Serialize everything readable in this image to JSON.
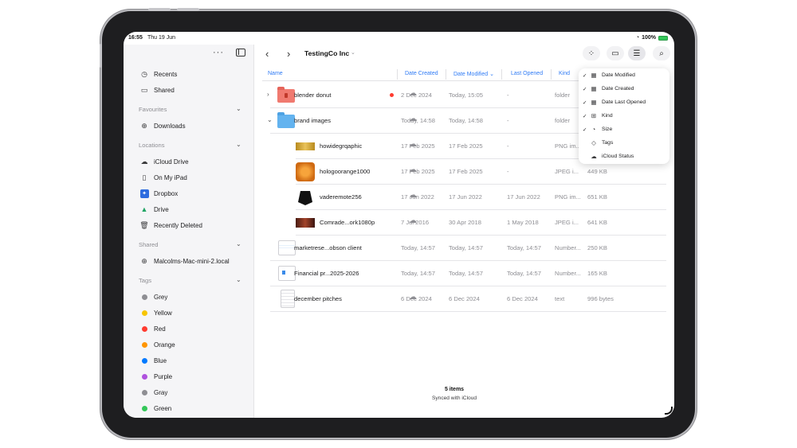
{
  "status_bar": {
    "time": "16:55",
    "date": "Thu 19 Jun",
    "battery": "100%"
  },
  "sidebar": {
    "more": "···",
    "items_top": [
      {
        "icon": "clock-icon",
        "label": "Recents"
      },
      {
        "icon": "shared-folder-icon",
        "label": "Shared"
      }
    ],
    "favourites": {
      "title": "Favourites",
      "items": [
        {
          "icon": "download-icon",
          "label": "Downloads"
        }
      ]
    },
    "locations": {
      "title": "Locations",
      "items": [
        {
          "icon": "icloud-icon",
          "label": "iCloud Drive"
        },
        {
          "icon": "ipad-icon",
          "label": "On My iPad"
        },
        {
          "icon": "dropbox-icon",
          "label": "Dropbox"
        },
        {
          "icon": "google-drive-icon",
          "label": "Drive"
        },
        {
          "icon": "trash-icon",
          "label": "Recently Deleted"
        }
      ]
    },
    "shared": {
      "title": "Shared",
      "items": [
        {
          "icon": "globe-icon",
          "label": "Malcolms-Mac-mini-2.local"
        }
      ]
    },
    "tags": {
      "title": "Tags",
      "items": [
        {
          "label": "Grey",
          "color": "#8e8e93"
        },
        {
          "label": "Yellow",
          "color": "#f7c500"
        },
        {
          "label": "Red",
          "color": "#ff3b30"
        },
        {
          "label": "Orange",
          "color": "#ff9500"
        },
        {
          "label": "Blue",
          "color": "#007aff"
        },
        {
          "label": "Purple",
          "color": "#af52de"
        },
        {
          "label": "Gray",
          "color": "#8e8e93"
        },
        {
          "label": "Green",
          "color": "#34c759"
        }
      ]
    }
  },
  "toolbar": {
    "title": "TestingCo Inc"
  },
  "columns": {
    "name": "Name",
    "date_created": "Date Created",
    "date_modified": "Date Modified",
    "last_opened": "Last Opened",
    "kind": "Kind"
  },
  "rows": [
    {
      "name": "blender donut",
      "created": "2 Dec 2024",
      "modified": "Today, 15:05",
      "opened": "-",
      "kind": "folder",
      "size": ""
    },
    {
      "name": "brand images",
      "created": "Today, 14:58",
      "modified": "Today, 14:58",
      "opened": "-",
      "kind": "folder",
      "size": ""
    },
    {
      "name": "howidegrqaphic",
      "created": "17 Feb 2025",
      "modified": "17 Feb 2025",
      "opened": "-",
      "kind": "PNG im...",
      "size": ""
    },
    {
      "name": "hologoorange1000",
      "created": "17 Feb 2025",
      "modified": "17 Feb 2025",
      "opened": "-",
      "kind": "JPEG i...",
      "size": "449 KB"
    },
    {
      "name": "vaderemote256",
      "created": "17 Jun 2022",
      "modified": "17 Jun 2022",
      "opened": "17 Jun 2022",
      "kind": "PNG im...",
      "size": "651 KB"
    },
    {
      "name": "Comrade...ork1080p",
      "created": "7 Jul 2016",
      "modified": "30 Apr 2018",
      "opened": "1 May 2018",
      "kind": "JPEG i...",
      "size": "641 KB"
    },
    {
      "name": "marketrese...obson client",
      "created": "Today, 14:57",
      "modified": "Today, 14:57",
      "opened": "Today, 14:57",
      "kind": "Number...",
      "size": "250 KB"
    },
    {
      "name": "Financial pr...2025-2026",
      "created": "Today, 14:57",
      "modified": "Today, 14:57",
      "opened": "Today, 14:57",
      "kind": "Number...",
      "size": "165 KB"
    },
    {
      "name": "december pitches",
      "created": "6 Dec 2024",
      "modified": "6 Dec 2024",
      "opened": "6 Dec 2024",
      "kind": "text",
      "size": "996 bytes"
    }
  ],
  "popover": {
    "items": [
      {
        "label": "Date Modified",
        "checked": true,
        "icon": "calendar-icon"
      },
      {
        "label": "Date Created",
        "checked": true,
        "icon": "calendar-icon"
      },
      {
        "label": "Date Last Opened",
        "checked": true,
        "icon": "calendar-clock-icon"
      },
      {
        "label": "Kind",
        "checked": true,
        "icon": "kind-icon"
      },
      {
        "label": "Size",
        "checked": true,
        "icon": "gauge-icon"
      },
      {
        "label": "Tags",
        "checked": false,
        "icon": "tag-icon"
      },
      {
        "label": "iCloud Status",
        "checked": false,
        "icon": "icloud-icon"
      }
    ]
  },
  "footer": {
    "count": "5 items",
    "sync": "Synced with iCloud"
  }
}
